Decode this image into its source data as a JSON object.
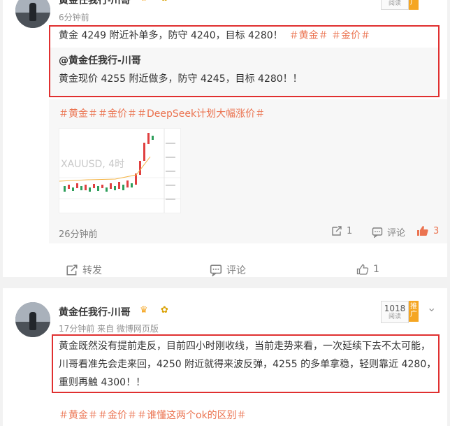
{
  "post1": {
    "username": "黄金任我行-川哥",
    "time": "6分钟前",
    "read_label": "阅读",
    "promo_label": "广",
    "text_prefix": "黄金 4249 附近补单多，防守 4240，目标 4280！",
    "text_tags": "＃黄金＃ ＃金价＃",
    "quoted_user": "@黄金任我行-川哥",
    "quoted_text": "黄金现价 4255 附近做多，防守 4245，目标 4280！！",
    "hashtags": "＃黄金＃＃金价＃＃DeepSeek计划大幅涨价＃",
    "chart_watermark": "XAUUSD, 4时",
    "inner_time": "26分钟前",
    "inner_repost_count": "1",
    "inner_comment_label": "评论",
    "inner_like_count": "3",
    "repost_label": "转发",
    "comment_label": "评论",
    "like_count": "1"
  },
  "post2": {
    "username": "黄金任我行-川哥",
    "meta": "17分钟前  来自 微博网页版",
    "read_count": "1018",
    "read_label": "阅读",
    "promo_label": "推广",
    "text": "黄金既然没有提前走反，目前四小时刚收线，当前走势来看，一次延续下去不太可能，川哥看准先会走来回，4250 附近就得来波反弹，4255 的多单拿稳，轻则靠近 4280，重则再触 4300！！",
    "hashtags": "＃黄金＃＃金价＃＃谁懂这两个ok的区别＃"
  },
  "colors": {
    "accent": "#eb7350",
    "highlight_box": "#e03030",
    "promo": "#f5a623"
  }
}
